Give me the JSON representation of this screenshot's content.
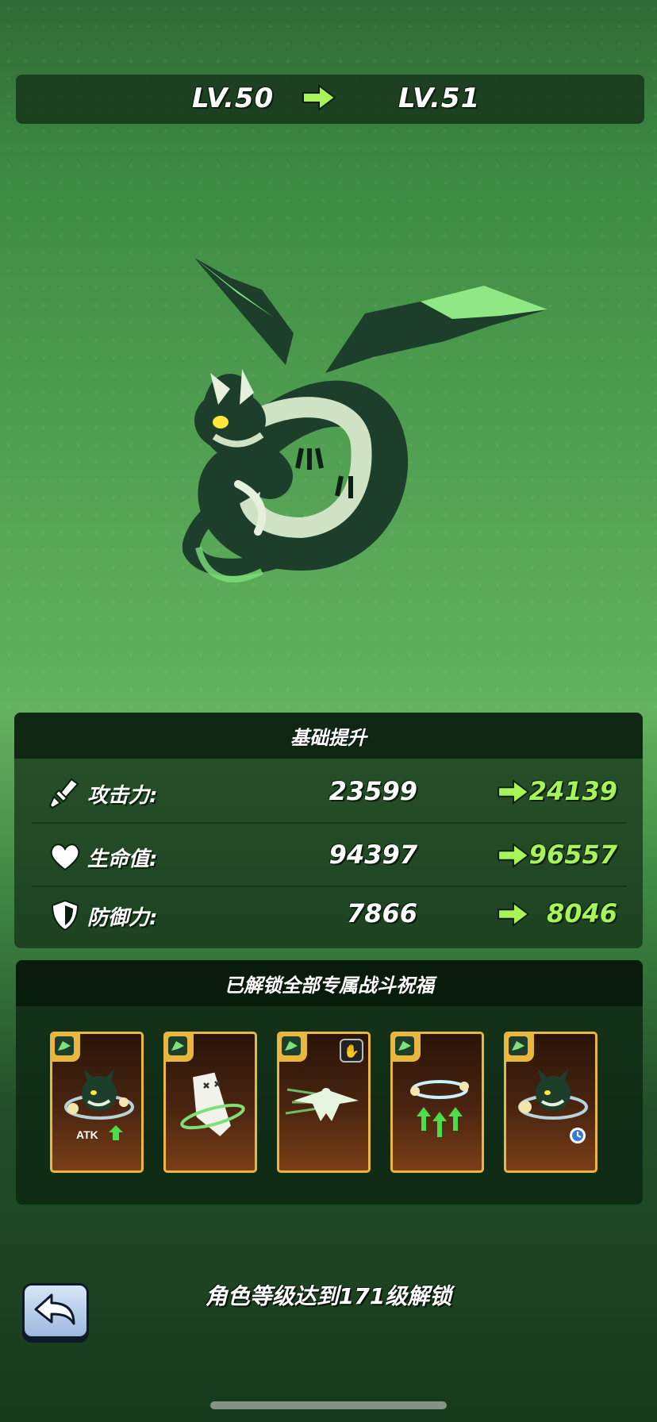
{
  "level": {
    "from": "LV.50",
    "to": "LV.51"
  },
  "stats_panel": {
    "title": "基础提升",
    "rows": [
      {
        "label": "攻击力:",
        "old": "23599",
        "new": "24139",
        "icon": "sword-icon"
      },
      {
        "label": "生命值:",
        "old": "94397",
        "new": "96557",
        "icon": "heart-icon"
      },
      {
        "label": "防御力:",
        "old": "7866",
        "new": "8046",
        "icon": "shield-icon"
      }
    ]
  },
  "blessings_panel": {
    "title": "已解锁全部专属战斗祝福",
    "cards": [
      {
        "icon": "dragon-atk-icon",
        "caption": "ATK"
      },
      {
        "icon": "ghost-spin-icon",
        "caption": ""
      },
      {
        "icon": "dragon-dash-icon",
        "caption": "",
        "badge": "handshake-icon"
      },
      {
        "icon": "orbit-arrows-icon",
        "caption": ""
      },
      {
        "icon": "dragon-clock-icon",
        "caption": ""
      }
    ]
  },
  "footer": {
    "unlock_text": "角色等级达到171级解锁",
    "back_icon": "back-arrow-icon"
  },
  "colors": {
    "new_value": "#a8f35a",
    "arrow": "#a8f35a",
    "card_border": "#e9b640"
  }
}
